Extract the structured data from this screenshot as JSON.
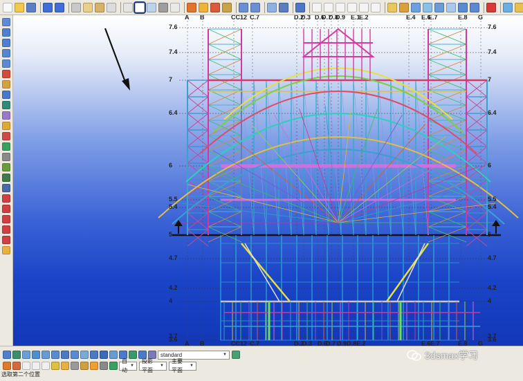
{
  "viewport": {
    "grid_labels_top": [
      "A",
      "B",
      "CC12",
      "C.7",
      "D.2",
      "D.3",
      "D.6",
      "D.7",
      "D.8",
      "D.9",
      "E.1",
      "E.2",
      "E.4",
      "E.6",
      "E.7",
      "E.8",
      "G"
    ],
    "grid_labels_bottom": [
      "A",
      "B",
      "CC12",
      "C.7",
      "D.2",
      "D.3",
      "D.6",
      "D.7",
      "D.9",
      "D.8",
      "E.2",
      "E.6",
      "E.7",
      "E.8",
      "G"
    ],
    "levels_left": [
      "7.6",
      "7.4",
      "7",
      "6.4",
      "6",
      "5.5",
      "5.4",
      "5",
      "4.7",
      "4.2",
      "4",
      "3.7",
      "3.6"
    ],
    "levels_right": [
      "7.6",
      "7.4",
      "7",
      "6.4",
      "6",
      "5.5",
      "5.4",
      "5",
      "4.7",
      "4.2",
      "4",
      "3.7",
      "3.6"
    ],
    "background_top_color": "#ffffff",
    "background_bottom_color": "#1237b8",
    "frame_colors": [
      "#d2308f",
      "#2aa0c7",
      "#e0b43c",
      "#3bbf5a",
      "#7a57d1",
      "#e05a2a",
      "#9fd13b",
      "#d26ad8"
    ]
  },
  "bottom": {
    "view_select": "standard",
    "dropdowns": [
      "自动",
      "投影平面",
      "主要平面"
    ]
  },
  "status": {
    "text": "选取第二个位置"
  },
  "watermark": {
    "text": "3dsmax学习"
  }
}
